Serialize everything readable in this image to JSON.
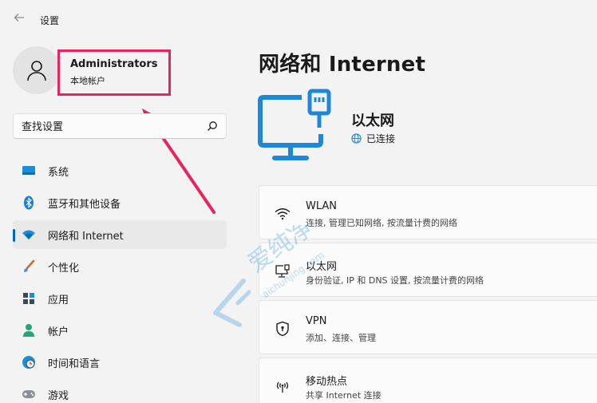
{
  "titlebar": {
    "app_title": "设置"
  },
  "profile": {
    "name": "Administrators",
    "type": "本地帐户"
  },
  "search": {
    "placeholder": "查找设置"
  },
  "nav": {
    "items": [
      {
        "label": "系统",
        "icon": "system-icon"
      },
      {
        "label": "蓝牙和其他设备",
        "icon": "bluetooth-icon"
      },
      {
        "label": "网络和 Internet",
        "icon": "wifi-network-icon",
        "active": true
      },
      {
        "label": "个性化",
        "icon": "brush-icon"
      },
      {
        "label": "应用",
        "icon": "apps-icon"
      },
      {
        "label": "帐户",
        "icon": "account-icon"
      },
      {
        "label": "时间和语言",
        "icon": "globe-clock-icon"
      },
      {
        "label": "游戏",
        "icon": "gamepad-icon"
      }
    ]
  },
  "main": {
    "title": "网络和 Internet",
    "hero": {
      "name": "以太网",
      "status": "已连接"
    },
    "cards": [
      {
        "title": "WLAN",
        "subtitle": "连接, 管理已知网络, 按流量计费的网络",
        "icon": "wifi-icon"
      },
      {
        "title": "以太网",
        "subtitle": "身份验证, IP 和 DNS 设置, 按流量计费的网络",
        "icon": "ethernet-icon"
      },
      {
        "title": "VPN",
        "subtitle": "添加、连接、管理",
        "icon": "vpn-shield-icon"
      },
      {
        "title": "移动热点",
        "subtitle": "共享 Internet 连接",
        "icon": "hotspot-icon"
      }
    ]
  },
  "watermark": {
    "text": "爱纯净",
    "url": "aichunjing.com"
  },
  "colors": {
    "accent": "#0067c0",
    "highlight": "#e8245f",
    "hero_blue": "#1e88d6"
  }
}
